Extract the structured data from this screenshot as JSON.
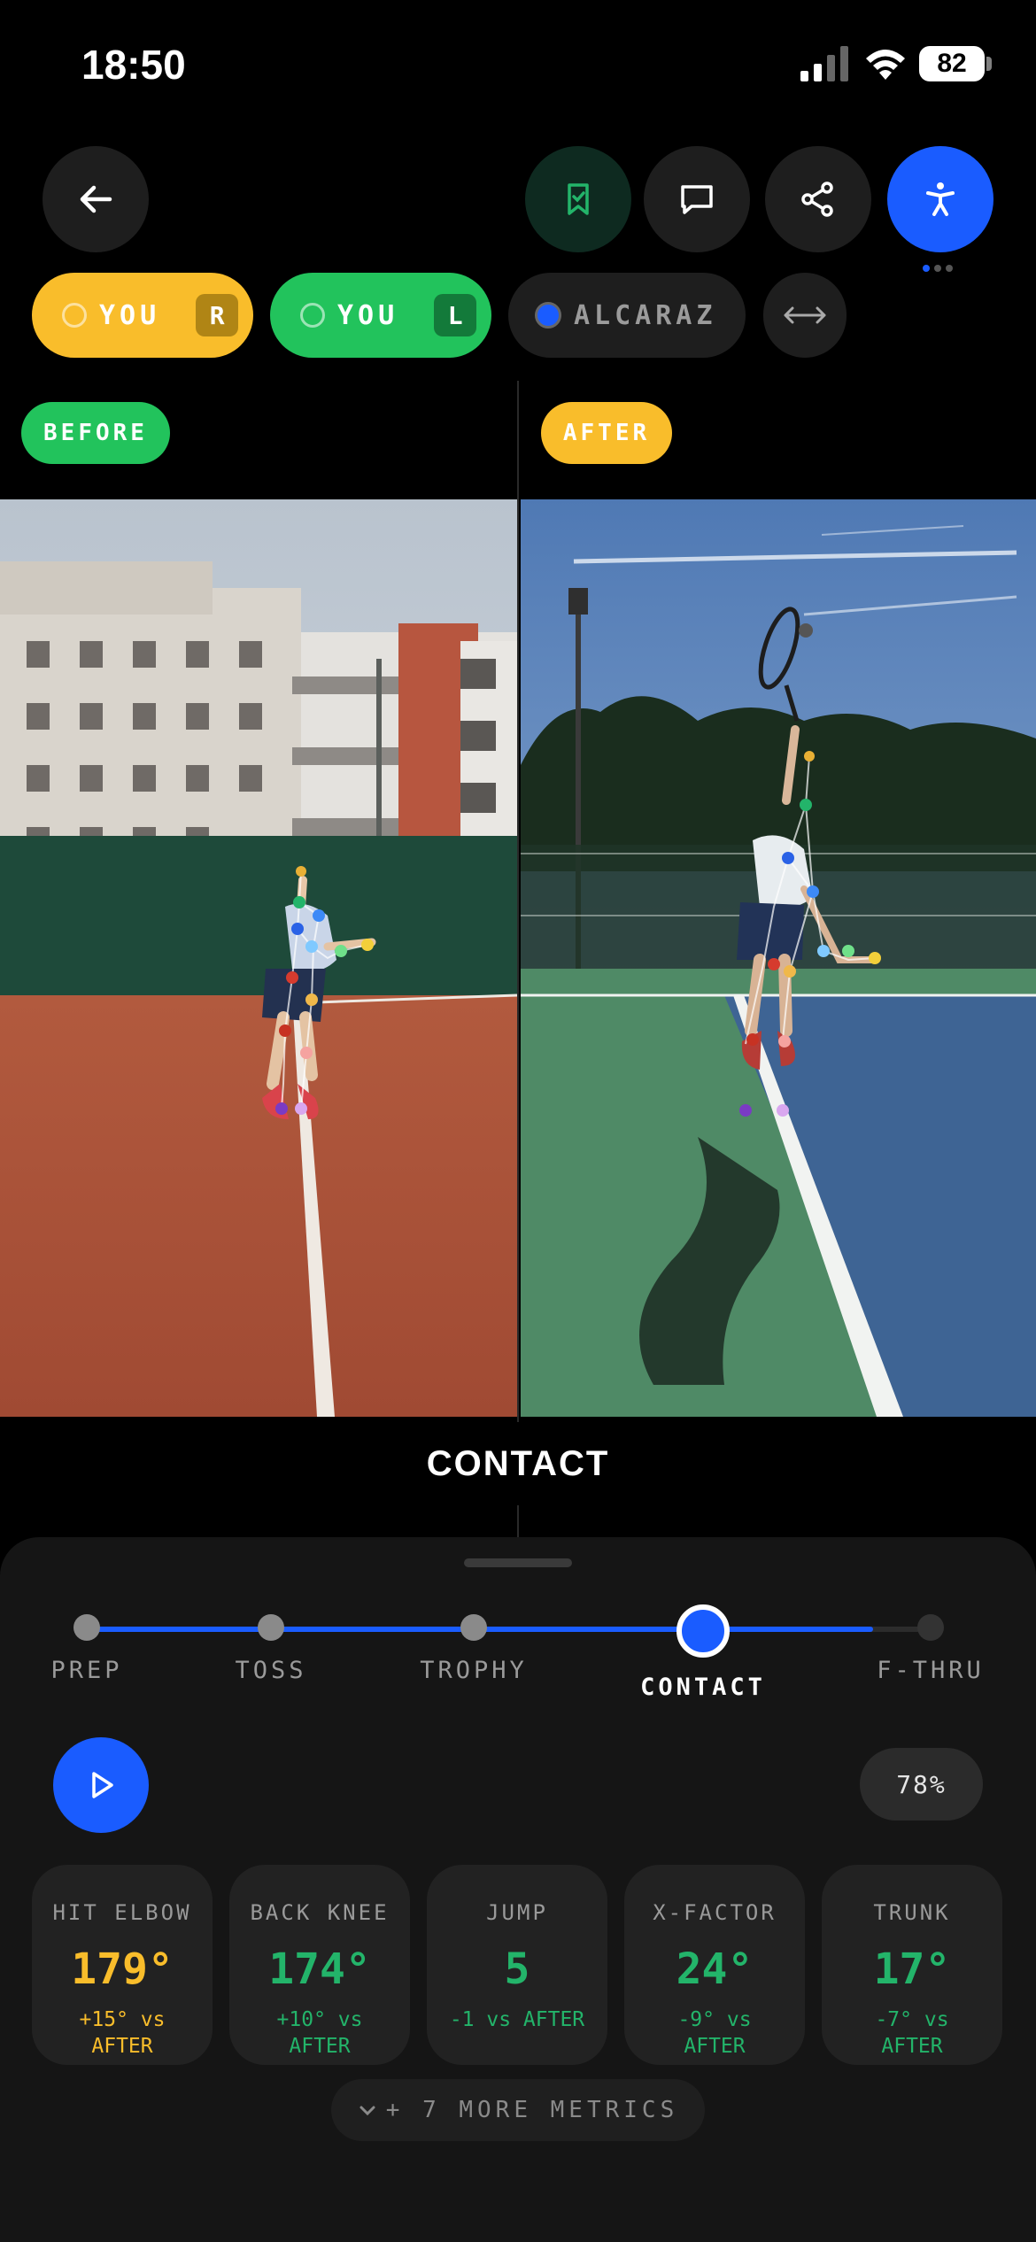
{
  "status": {
    "time": "18:50",
    "battery": "82"
  },
  "header": {
    "icons": [
      "back-arrow-icon",
      "bookmark-check-icon",
      "comment-icon",
      "share-icon",
      "accessibility-pose-icon"
    ]
  },
  "pills": {
    "you_r": {
      "label": "YOU",
      "tag": "R",
      "color": "#f9bd2b"
    },
    "you_l": {
      "label": "YOU",
      "tag": "L",
      "color": "#22c35c"
    },
    "pro": {
      "label": "ALCARAZ",
      "color": "#1a5cff"
    },
    "swap_icon": "swap-horizontal-icon"
  },
  "compare": {
    "before_label": "BEFORE",
    "after_label": "AFTER",
    "phase_chip": "CONTACT"
  },
  "timeline": {
    "phases": [
      "PREP",
      "TOSS",
      "TROPHY",
      "CONTACT",
      "F-THRU"
    ],
    "active": "CONTACT"
  },
  "playback": {
    "progress_label": "78%",
    "progress": 0.78
  },
  "metrics": [
    {
      "title": "HIT ELBOW",
      "value": "179°",
      "delta": "+15° vs",
      "ref": "AFTER",
      "color": "#f9bd2b"
    },
    {
      "title": "BACK KNEE",
      "value": "174°",
      "delta": "+10° vs",
      "ref": "AFTER",
      "color": "#23b46a"
    },
    {
      "title": "JUMP",
      "value": "5",
      "delta": "-1 vs AFTER",
      "ref": "",
      "color": "#23b46a"
    },
    {
      "title": "X-FACTOR",
      "value": "24°",
      "delta": "-9° vs",
      "ref": "AFTER",
      "color": "#23b46a"
    },
    {
      "title": "TRUNK",
      "value": "17°",
      "delta": "-7° vs",
      "ref": "AFTER",
      "color": "#23b46a"
    }
  ],
  "more_metrics": "+ 7 MORE METRICS"
}
